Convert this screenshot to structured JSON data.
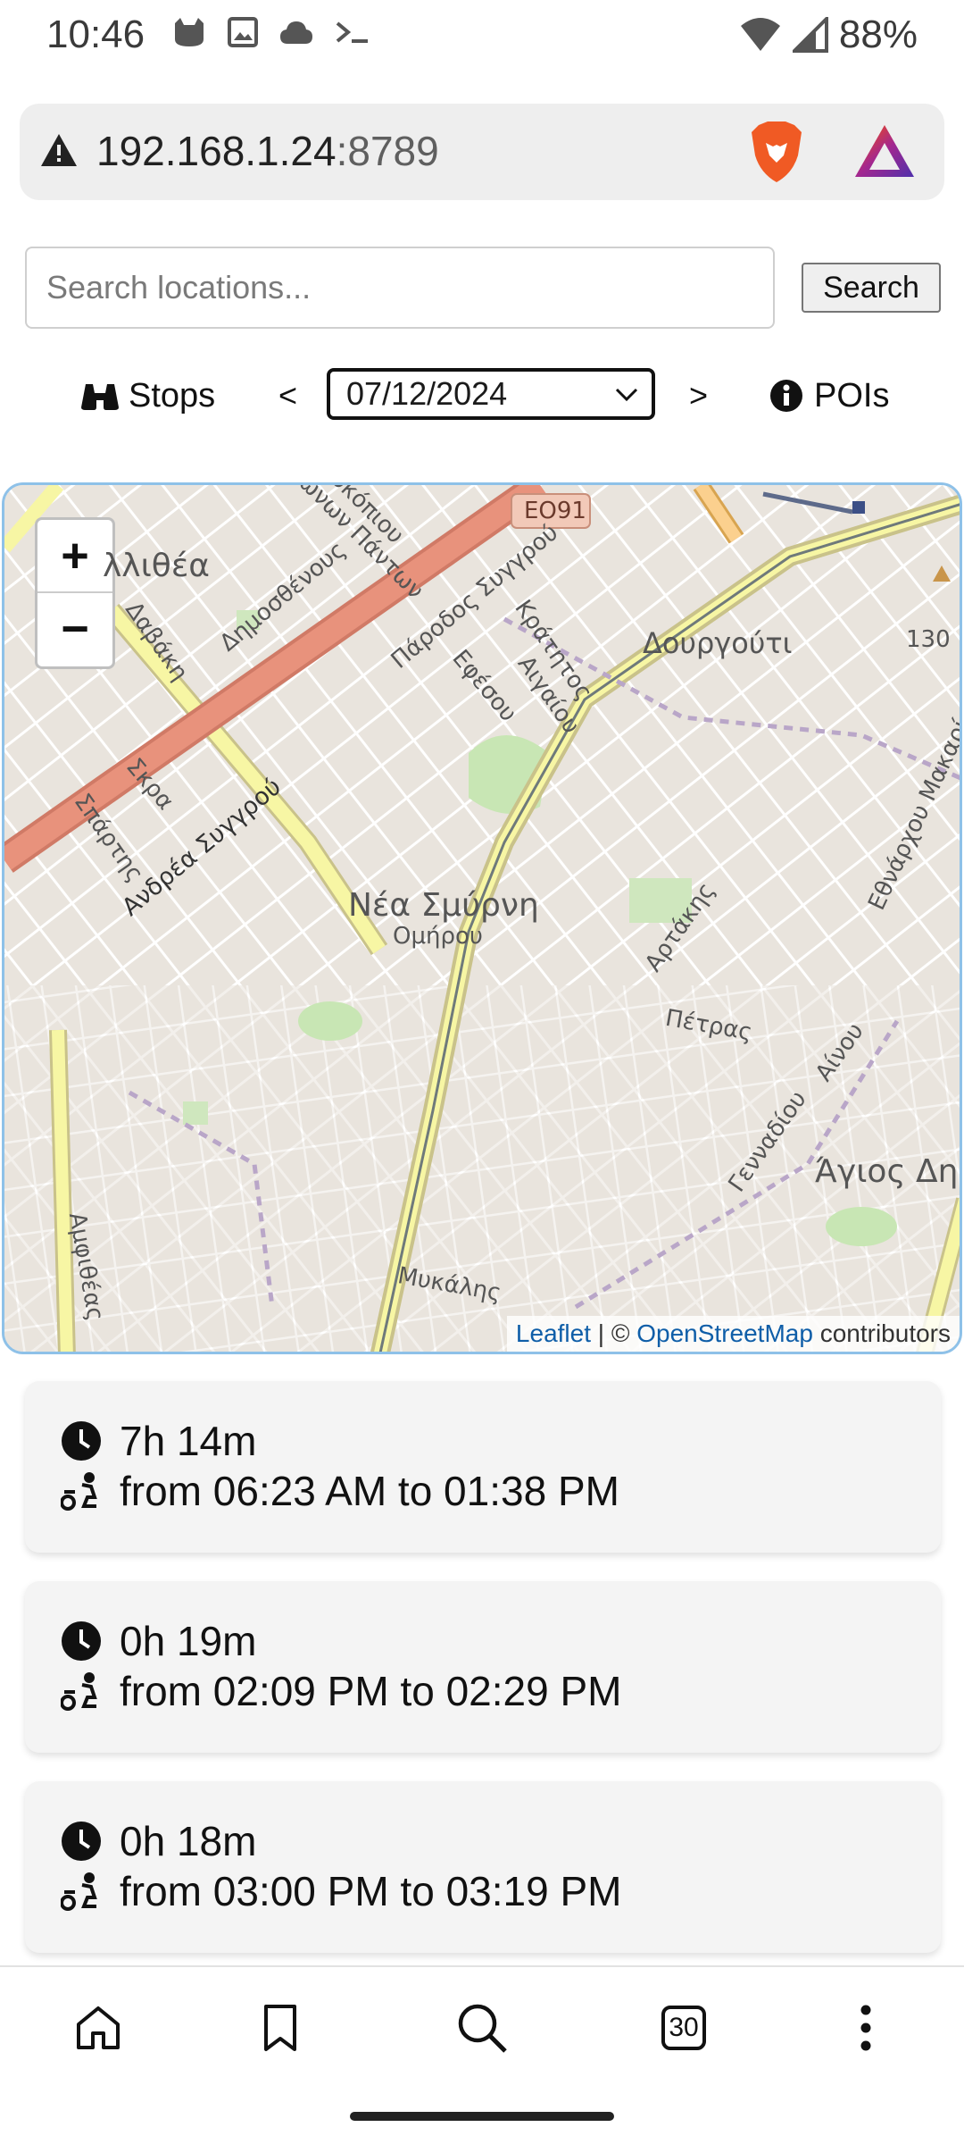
{
  "status_bar": {
    "time": "10:46",
    "battery": "88%",
    "icons": [
      "cat-icon",
      "image-icon",
      "cloud-icon",
      "terminal-icon",
      "wifi-icon",
      "signal-icon"
    ]
  },
  "browser": {
    "url_host": "192.168.1.24",
    "url_port": ":8789",
    "tabs_count": "30"
  },
  "search": {
    "placeholder": "Search locations...",
    "button_label": "Search"
  },
  "controls": {
    "stops_label": "Stops",
    "prev_label": "<",
    "date_value": "07/12/2024",
    "next_label": ">",
    "pois_label": "POIs"
  },
  "map": {
    "zoom_in": "+",
    "zoom_out": "−",
    "labels": {
      "kallithea": "λλιθέα",
      "daviki": "Δαβάκη",
      "dimosthenous": "Δημοσθένους",
      "panton": "ιώνων Πάντων",
      "rokopiou": "οκόπιου",
      "eo91": "ΕΟ91",
      "paradosos": "Πάροδος Συγγρού",
      "efesou": "Εφέσου",
      "kratitos": "Κράτητος",
      "aigaiou": "Αιγαίου",
      "dourgouti": "Δουργούτι",
      "skra": "Σκρα",
      "spartis": "Σπάρτης",
      "andrea": "Ανδρέα Συγγρού",
      "nea_smyrni": "Νέα Σμύρνη",
      "omirou": "Ομήρου",
      "artakis": "Αρτάκης",
      "petras": "Πέτρας",
      "ainou": "Αίνου",
      "gennadiou": "Γενναδίου",
      "agios_dimitrios": "Άγιος Δημ",
      "ethnarchou": "Εθνάρχου Μακαρίου",
      "amfitheas": "Αμφιθέας",
      "mykalis": "Μυκάλης",
      "elevation": "130 m"
    },
    "attribution_leaflet": "Leaflet",
    "attribution_sep": " | © ",
    "attribution_osm": "OpenStreetMap",
    "attribution_tail": " contributors"
  },
  "stops": [
    {
      "duration": "7h 14m",
      "range": "from 06:23 AM to 01:38 PM"
    },
    {
      "duration": "0h 19m",
      "range": "from 02:09 PM to 02:29 PM"
    },
    {
      "duration": "0h 18m",
      "range": "from 03:00 PM to 03:19 PM"
    }
  ],
  "colors": {
    "map_border": "#8ec1e8",
    "primary_road": "#e8927c",
    "secondary_road": "#f7f6a4",
    "rail": "#8a8a8a",
    "brave_orange": "#f05a24"
  }
}
